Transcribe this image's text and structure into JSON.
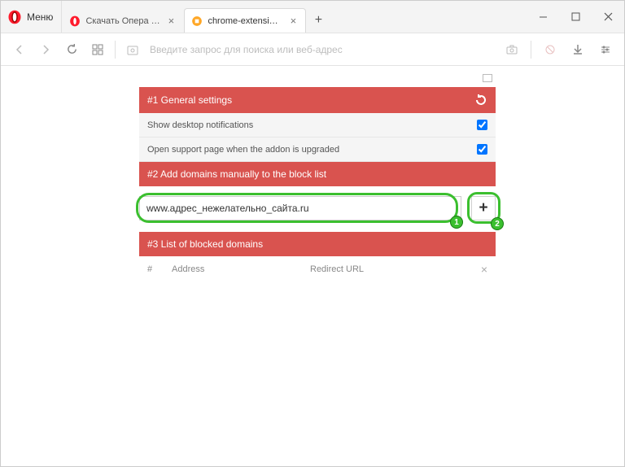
{
  "window": {
    "menu_label": "Меню"
  },
  "tabs": [
    {
      "label": "Скачать Опера для компь",
      "active": false,
      "favicon": "opera"
    },
    {
      "label": "chrome-extension://chnfku",
      "active": true,
      "favicon": "ext"
    }
  ],
  "addressbar": {
    "placeholder": "Введите запрос для поиска или веб-адрес"
  },
  "sections": {
    "general": {
      "title": "#1 General settings",
      "items": [
        {
          "label": "Show desktop notifications",
          "checked": true
        },
        {
          "label": "Open support page when the addon is upgraded",
          "checked": true
        }
      ]
    },
    "add": {
      "title": "#2 Add domains manually to the block list",
      "input_value": "www.адрес_нежелательно_сайта.ru",
      "add_btn_label": "+"
    },
    "blocked": {
      "title": "#3 List of blocked domains",
      "columns": {
        "hash": "#",
        "address": "Address",
        "redirect": "Redirect URL",
        "delete": "×"
      }
    }
  },
  "callouts": {
    "b1": "1",
    "b2": "2"
  }
}
